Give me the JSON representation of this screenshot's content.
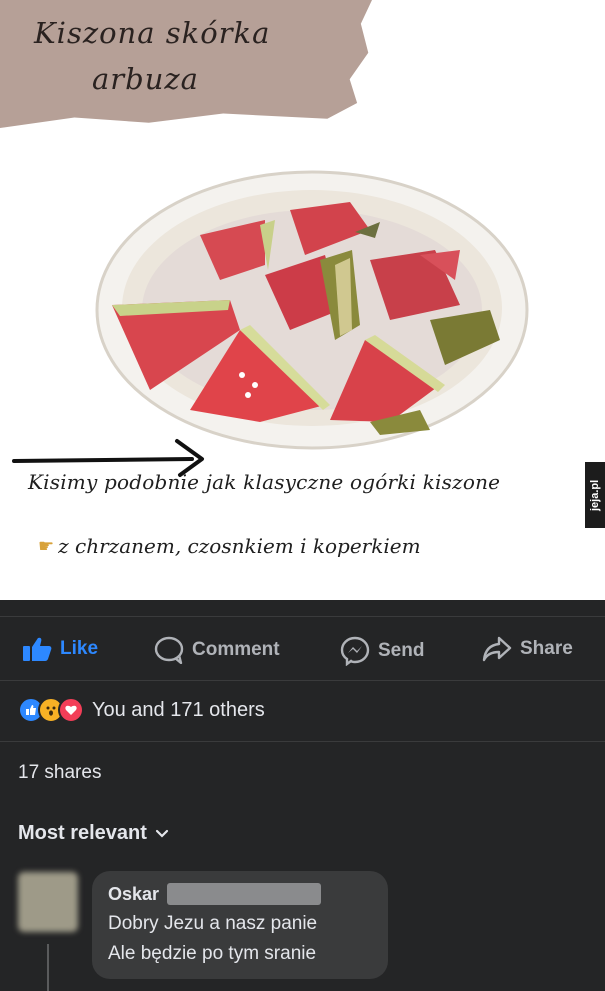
{
  "post": {
    "title_line1": "Kiszona skórka",
    "title_line2": "arbuza",
    "caption_line1": "Kisimy podobnie jak klasyczne ogórki kiszone",
    "caption_line2": "z chrzanem, czosnkiem i koperkiem",
    "watermark": "jeja.pl"
  },
  "actions": {
    "like": "Like",
    "comment": "Comment",
    "send": "Send",
    "share": "Share"
  },
  "reactions": {
    "summary": "You and 171 others"
  },
  "shares": "17 shares",
  "sort": "Most relevant",
  "comment": {
    "author": "Oskar",
    "line1": "Dobry Jezu a nasz panie",
    "line2": "Ale będzie po tym sranie"
  },
  "colors": {
    "background": "#242526",
    "like_blue": "#2d88ff",
    "bubble": "#3a3b3c",
    "text": "#e4e6eb",
    "muted": "#b0b3b8"
  }
}
